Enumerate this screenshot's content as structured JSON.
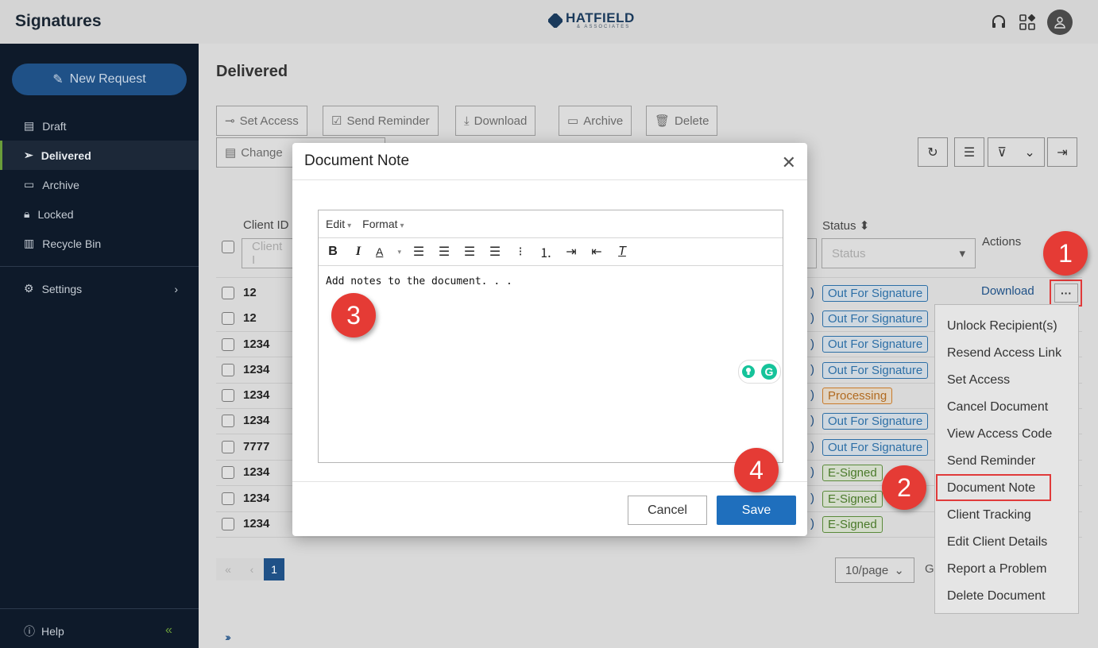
{
  "app": {
    "title": "Signatures",
    "logo_name": "HATFIELD",
    "logo_sub": "& ASSOCIATES"
  },
  "sidebar": {
    "new_request": "New Request",
    "items": [
      {
        "label": "Draft",
        "icon": "document-icon"
      },
      {
        "label": "Delivered",
        "icon": "send-icon"
      },
      {
        "label": "Archive",
        "icon": "archive-icon"
      },
      {
        "label": "Locked",
        "icon": "lock-icon"
      },
      {
        "label": "Recycle Bin",
        "icon": "trash-icon"
      }
    ],
    "settings": "Settings",
    "help": "Help"
  },
  "main": {
    "title": "Delivered",
    "toolbar": {
      "set_access": "Set Access",
      "send_reminder": "Send Reminder",
      "download": "Download",
      "archive": "Archive",
      "delete": "Delete",
      "change": "Change"
    },
    "columns": {
      "client_id": "Client ID",
      "status": "Status",
      "actions": "Actions"
    },
    "filters": {
      "client_placeholder": "Client I",
      "status_placeholder": "Status"
    },
    "rows": [
      {
        "id": "12",
        "status": "Out For Signature"
      },
      {
        "id": "12",
        "status": "Out For Signature"
      },
      {
        "id": "1234",
        "status": "Out For Signature"
      },
      {
        "id": "1234",
        "status": "Out For Signature"
      },
      {
        "id": "1234",
        "status": "Processing"
      },
      {
        "id": "1234",
        "status": "Out For Signature"
      },
      {
        "id": "7777",
        "status": "Out For Signature"
      },
      {
        "id": "1234",
        "status": "E-Signed"
      },
      {
        "id": "1234",
        "status": "E-Signed"
      },
      {
        "id": "1234",
        "status": "E-Signed"
      }
    ],
    "row_download": "Download",
    "pager": {
      "current": "1",
      "per_page": "10/page",
      "goto": "G"
    }
  },
  "menu": {
    "items": [
      "Unlock Recipient(s)",
      "Resend Access Link",
      "Set Access",
      "Cancel Document",
      "View Access Code",
      "Send Reminder",
      "Document Note",
      "Client Tracking",
      "Edit Client Details",
      "Report a Problem",
      "Delete Document"
    ]
  },
  "modal": {
    "title": "Document Note",
    "menu_edit": "Edit",
    "menu_format": "Format",
    "body_text": "Add notes to the document. . .",
    "cancel": "Cancel",
    "save": "Save"
  },
  "steps": [
    "1",
    "2",
    "3",
    "4"
  ],
  "colors": {
    "sidebar": "#0e1a2a",
    "accent": "#1f5187",
    "save": "#1f6fbd",
    "marker": "#e53b35"
  }
}
